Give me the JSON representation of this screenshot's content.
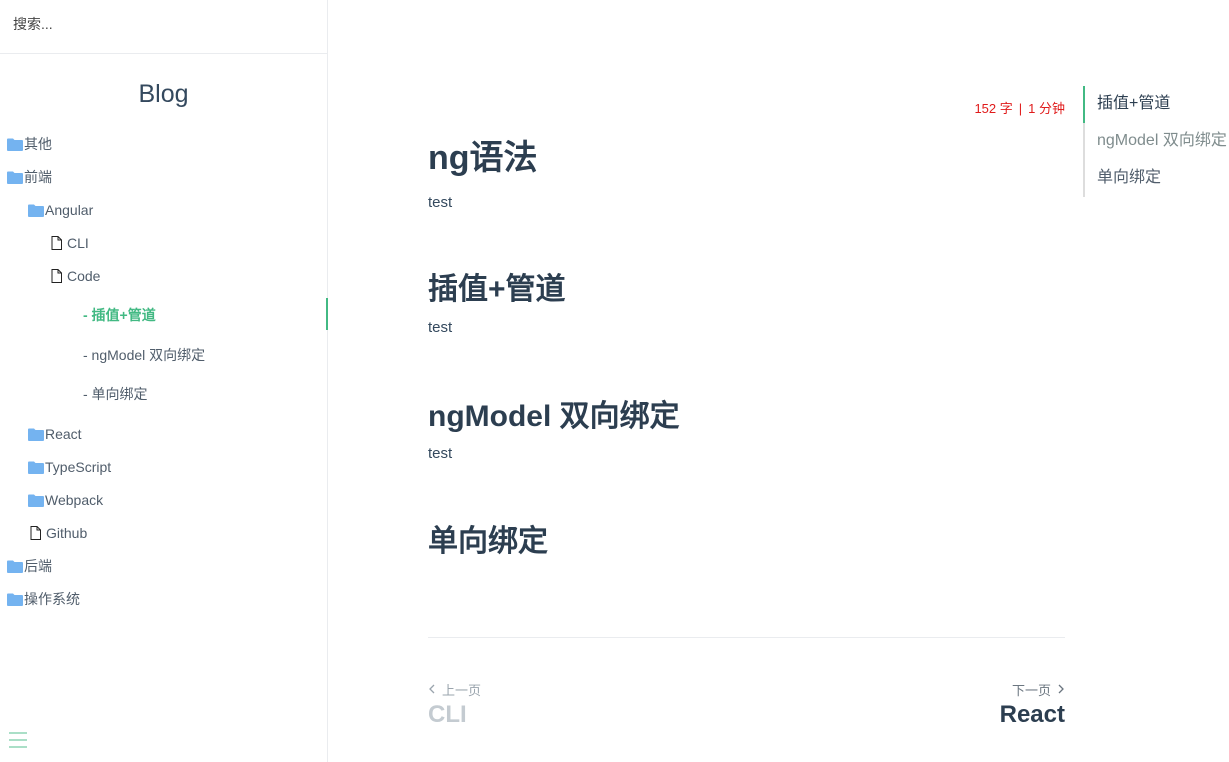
{
  "sidebar": {
    "search_placeholder": "搜索...",
    "app_name": "Blog",
    "tree": {
      "other": "其他",
      "frontend": "前端",
      "angular": "Angular",
      "cli": "CLI",
      "code": "Code",
      "sub_items": [
        "- 插值+管道",
        "- ngModel 双向绑定",
        "- 单向绑定"
      ],
      "react": "React",
      "typescript": "TypeScript",
      "webpack": "Webpack",
      "github": "Github",
      "backend": "后端",
      "os": "操作系统"
    }
  },
  "main": {
    "word_count": "152 字",
    "read_time": "1 分钟",
    "separator": "|",
    "title": "ng语法",
    "sections": [
      {
        "text": "test"
      },
      {
        "heading": "插值+管道",
        "text": "test"
      },
      {
        "heading": "ngModel 双向绑定",
        "text": "test"
      },
      {
        "heading": "单向绑定"
      }
    ],
    "pagination": {
      "prev_label": "上一页",
      "prev_title": "CLI",
      "next_label": "下一页",
      "next_title": "React"
    }
  },
  "toc": {
    "items": [
      "插值+管道",
      "ngModel 双向绑定",
      "单向绑定"
    ]
  },
  "colors": {
    "accent": "#42b983",
    "meta": "#e01b1b",
    "folder": "#74b3f0"
  },
  "icons": {
    "folder": "folder-icon",
    "file": "file-icon",
    "menu": "hamburger-menu-icon"
  }
}
